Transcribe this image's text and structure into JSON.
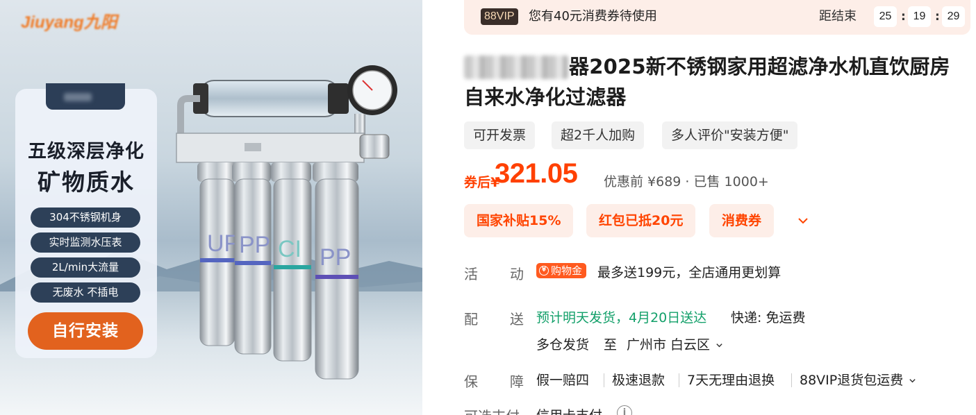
{
  "left_panel": {
    "brand_logo": "Jiuyang九阳",
    "card": {
      "headline_1": "五级深层净化",
      "headline_2": "矿物质水",
      "features": [
        "304不锈钢机身",
        "实时监测水压表",
        "2L/min大流量",
        "无废水 不插电"
      ],
      "install_button": "自行安装"
    },
    "filter_labels": [
      "UF",
      "PP",
      "CI",
      "PP"
    ]
  },
  "vip_bar": {
    "badge": "88VIP",
    "message": "您有40元消费券待使用",
    "countdown_label": "距结束",
    "countdown": {
      "hours": "25",
      "minutes": "19",
      "seconds": "29"
    },
    "separator": ":"
  },
  "product": {
    "title": "器2025新不锈钢家用超滤净水机直饮厨房自来水净化过滤器",
    "tags": [
      "可开发票",
      "超2千人加购",
      "多人评价\"安装方便\""
    ],
    "price": {
      "prefix": "券后",
      "currency": "¥",
      "value": "321.05",
      "original_and_sold": "优惠前 ¥689 · 已售 1000+"
    },
    "coupons": [
      "国家补贴15%",
      "红包已抵20元",
      "消费券"
    ]
  },
  "details": {
    "promotion": {
      "label_a": "活",
      "label_b": "动",
      "badge": "购物金",
      "text": "最多送199元，全店通用更划算"
    },
    "delivery": {
      "label_a": "配",
      "label_b": "送",
      "estimate": "预计明天发货，4月20日送达",
      "shipping": "快递: 免运费",
      "origin": "多仓发货",
      "to": "至",
      "destination": "广州市 白云区"
    },
    "guarantee": {
      "label_a": "保",
      "label_b": "障",
      "items": [
        "假一赔四",
        "极速退款",
        "7天无理由退换",
        "88VIP退货包运费"
      ]
    },
    "payment": {
      "label": "可选支付",
      "method": "信用卡支付"
    }
  },
  "colors": {
    "accent_orange": "#ff4000",
    "install_button": "#e2621e",
    "feature_pill": "#2d4058",
    "delivery_green": "#13a06a",
    "coupon_bg": "#fdeee8"
  }
}
